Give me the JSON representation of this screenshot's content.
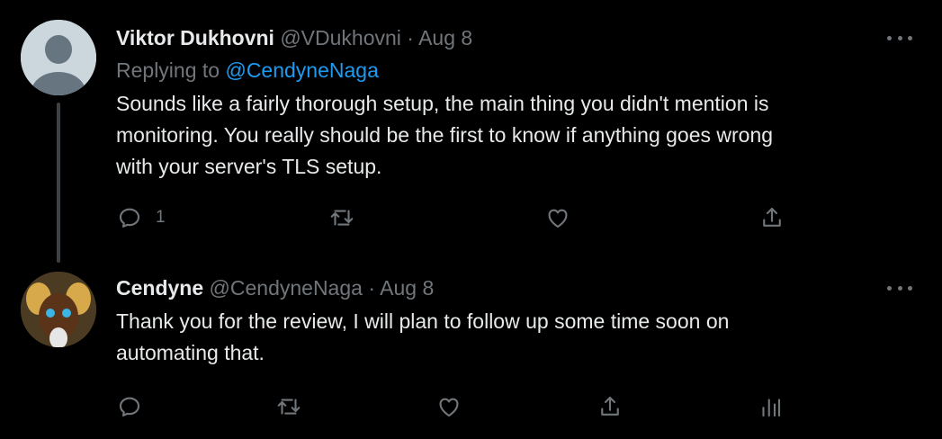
{
  "tweets": [
    {
      "name": "Viktor Dukhovni",
      "handle": "@VDukhovni",
      "separator": "·",
      "date": "Aug 8",
      "replying_prefix": "Replying to",
      "replying_to": "@CendyneNaga",
      "lines": [
        "Sounds like a fairly thorough setup, the main thing you didn't mention is",
        "monitoring. You really should be the first to know if anything goes wrong",
        "with your server's TLS setup."
      ],
      "reply_count": "1",
      "actions": [
        "reply-icon",
        "retweet-icon",
        "like-icon",
        "share-icon"
      ]
    },
    {
      "name": "Cendyne",
      "handle": "@CendyneNaga",
      "separator": "·",
      "date": "Aug 8",
      "lines": [
        "Thank you for the review, I will plan to follow up some time soon on",
        "automating that."
      ],
      "actions": [
        "reply-icon",
        "retweet-icon",
        "like-icon",
        "share-icon",
        "analytics-icon"
      ]
    }
  ],
  "colors": {
    "background": "#000000",
    "text": "#e7e9ea",
    "muted": "#71767b",
    "link": "#1d9bf0",
    "thread_line": "#3e4144"
  }
}
